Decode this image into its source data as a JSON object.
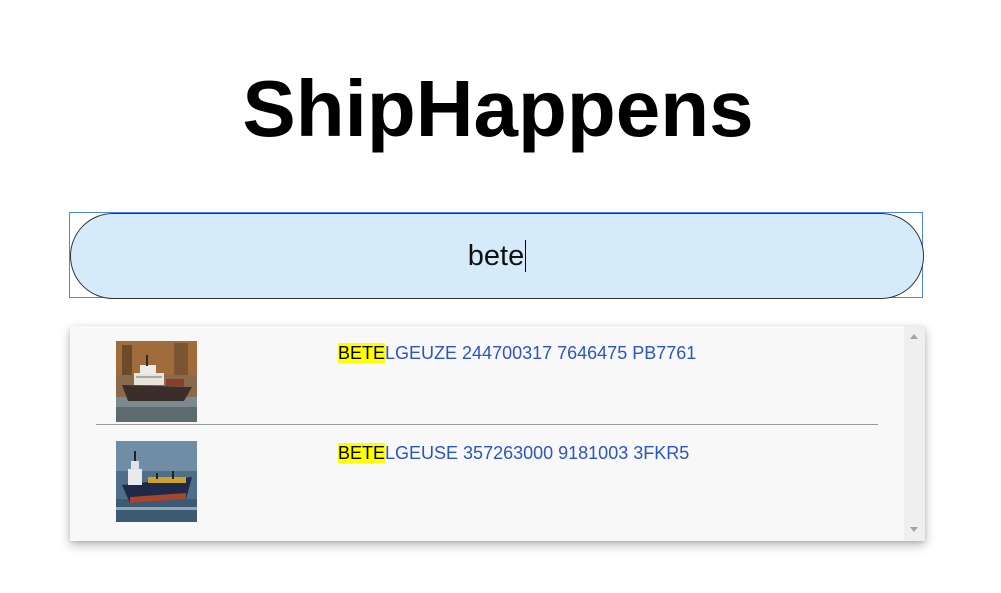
{
  "app": {
    "title": "ShipHappens"
  },
  "search": {
    "value": "bete"
  },
  "results": [
    {
      "highlight": "BETE",
      "rest": "LGEUZE 244700317 7646475 PB7761",
      "thumbnail": "ship-photo"
    },
    {
      "highlight": "BETE",
      "rest": "LGEUSE 357263000 9181003 3FKR5",
      "thumbnail": "ship-photo"
    }
  ],
  "colors": {
    "search_background": "#d6ebf9",
    "focus_ring": "#4a84ee",
    "result_text": "#2a54c8",
    "highlight": "#ffff00",
    "results_background": "#f8f8f8"
  }
}
